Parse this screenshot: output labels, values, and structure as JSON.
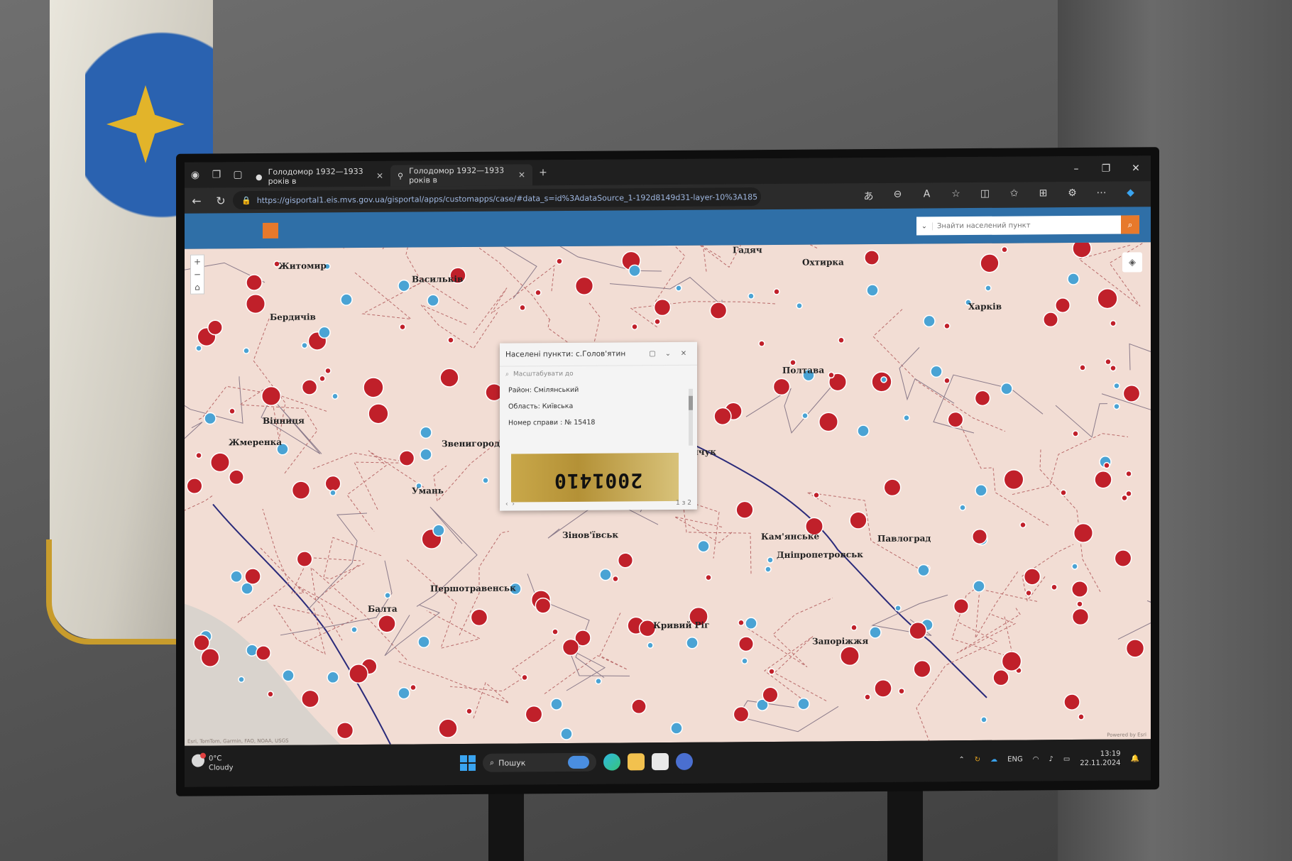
{
  "browser": {
    "tabs": [
      {
        "label": "Голодомор 1932—1933 років в",
        "active": false
      },
      {
        "label": "Голодомор 1932—1933 років в",
        "active": true
      }
    ],
    "new_tab_label": "+",
    "url": "https://gisportal1.eis.mvs.gov.ua/gisportal/apps/customapps/case/#data_s=id%3AdataSource_1-192d8149d31-layer-10%3A185",
    "icons": [
      "read-aloud-icon",
      "zoom-out-icon",
      "text-size-icon",
      "favorite-star-icon",
      "split-screen-icon",
      "favorites-icon",
      "collections-icon",
      "extensions-icon",
      "more-icon",
      "copilot-icon"
    ]
  },
  "app": {
    "brand_color": "#2f6fa7",
    "accent_color": "#e7792b",
    "search_placeholder": "Знайти населений пункт"
  },
  "map": {
    "cities": [
      "Житомир",
      "Бердичів",
      "Васильків",
      "Вінниця",
      "Жмеренка",
      "Звенигородка",
      "Умань",
      "Кременчук",
      "Зінов'ївськ",
      "Першотравенськ",
      "Балта",
      "Кривий Ріг",
      "Полтава",
      "Гадяч",
      "Охтирка",
      "Харків",
      "Кам'янське",
      "Дніпропетровськ",
      "Павлоград",
      "Запоріжжя"
    ],
    "marker_color_red": "#c0202a",
    "marker_color_blue": "#4aa3d4",
    "attribution": "Esri, TomTom, Garmin, FAO, NOAA, USGS",
    "powered_by": "Powered by Esri"
  },
  "popup": {
    "title": "Населені пункти: с.Голов'ятин",
    "zoom_to_label": "Масштабувати до",
    "fields": [
      {
        "label": "Район: Смілянський"
      },
      {
        "label": "Область: Київська"
      },
      {
        "label": "Номер справи : № 15418"
      }
    ],
    "image_stamp": "2001410",
    "pager": "1 з 2"
  },
  "taskbar": {
    "weather_temp": "0°C",
    "weather_desc": "Cloudy",
    "search_label": "Пошук",
    "lang": "ENG",
    "time": "13:19",
    "date": "22.11.2024"
  }
}
